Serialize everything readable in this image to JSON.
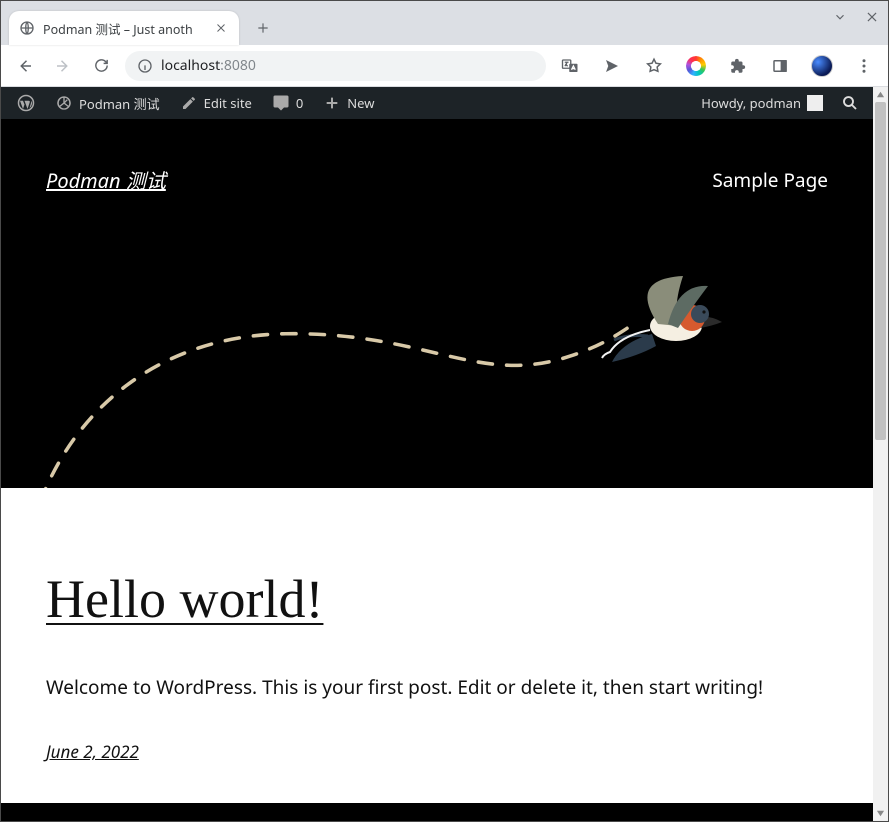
{
  "browser": {
    "tab_title": "Podman 测试 – Just anoth",
    "url_host": "localhost",
    "url_port": ":8080"
  },
  "wp_admin": {
    "site_name": "Podman 测试",
    "edit_site": "Edit site",
    "comments_count": "0",
    "new_label": "New",
    "greeting": "Howdy, podman"
  },
  "site": {
    "title": "Podman 测试",
    "nav_item": "Sample Page"
  },
  "post": {
    "title": "Hello world!",
    "excerpt": "Welcome to WordPress. This is your first post. Edit or delete it, then start writing!",
    "date": "June 2, 2022"
  }
}
